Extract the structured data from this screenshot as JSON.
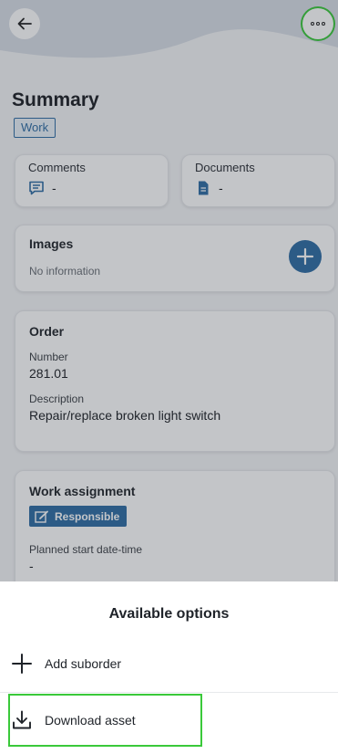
{
  "header": {
    "back_icon": "arrow-left-icon",
    "more_icon": "more-horizontal-icon"
  },
  "page": {
    "title": "Summary",
    "tag": "Work"
  },
  "stats": [
    {
      "label": "Comments",
      "icon": "comment-icon",
      "value": "-"
    },
    {
      "label": "Documents",
      "icon": "document-icon",
      "value": "-"
    }
  ],
  "images": {
    "title": "Images",
    "empty_text": "No information",
    "add_icon": "plus-icon"
  },
  "order": {
    "title": "Order",
    "number_label": "Number",
    "number_value": "281.01",
    "description_label": "Description",
    "description_value": "Repair/replace broken light switch"
  },
  "work_assignment": {
    "title": "Work assignment",
    "badge": "Responsible",
    "planned_start_label": "Planned start date-time",
    "planned_start_value": "-"
  },
  "sheet": {
    "title": "Available options",
    "items": [
      {
        "label": "Add suborder",
        "icon": "plus-icon"
      },
      {
        "label": "Download asset",
        "icon": "download-icon"
      }
    ]
  },
  "colors": {
    "accent": "#2e6ca4",
    "highlight": "#3ac93a",
    "overlay": "rgba(40,46,56,0.28)"
  }
}
